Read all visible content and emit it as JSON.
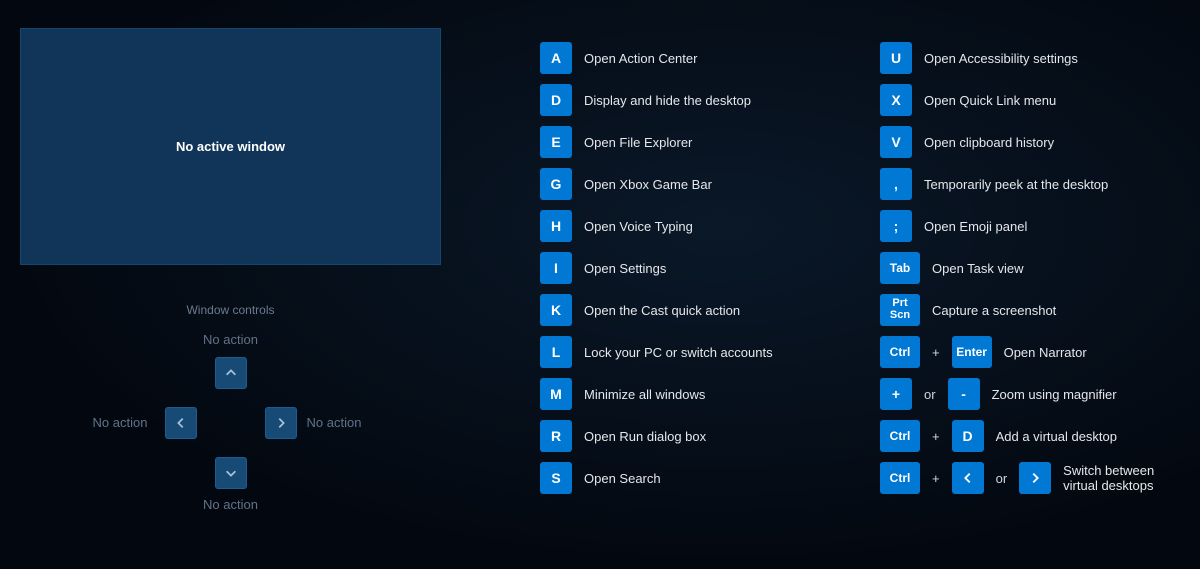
{
  "preview_text": "No active window",
  "window_controls_title": "Window controls",
  "dpad": {
    "up_label": "No action",
    "down_label": "No action",
    "left_label": "No action",
    "right_label": "No action"
  },
  "connectors": {
    "plus": "+",
    "or": "or"
  },
  "column1": [
    {
      "key": "A",
      "desc": "Open Action Center"
    },
    {
      "key": "D",
      "desc": "Display and hide the desktop"
    },
    {
      "key": "E",
      "desc": "Open File Explorer"
    },
    {
      "key": "G",
      "desc": "Open Xbox Game Bar"
    },
    {
      "key": "H",
      "desc": "Open Voice Typing"
    },
    {
      "key": "I",
      "desc": "Open Settings"
    },
    {
      "key": "K",
      "desc": "Open the Cast quick action"
    },
    {
      "key": "L",
      "desc": "Lock your PC or switch accounts"
    },
    {
      "key": "M",
      "desc": "Minimize all windows"
    },
    {
      "key": "R",
      "desc": "Open Run dialog box"
    },
    {
      "key": "S",
      "desc": "Open Search"
    }
  ],
  "column2_simple": [
    {
      "key": "U",
      "desc": "Open Accessibility settings"
    },
    {
      "key": "X",
      "desc": "Open Quick Link menu"
    },
    {
      "key": "V",
      "desc": "Open clipboard history"
    },
    {
      "key": ",",
      "desc": "Temporarily peek at the desktop"
    },
    {
      "key": ";",
      "desc": "Open Emoji panel"
    },
    {
      "key": "Tab",
      "desc": "Open Task view",
      "wide": true
    },
    {
      "key": "Prt\nScn",
      "desc": "Capture a screenshot",
      "tall": true
    }
  ],
  "combo_narrator": {
    "k1": "Ctrl",
    "k2": "Enter",
    "desc": "Open Narrator"
  },
  "combo_zoom": {
    "k1": "+",
    "k2": "-",
    "desc": "Zoom using magnifier"
  },
  "combo_add_desktop": {
    "k1": "Ctrl",
    "k2": "D",
    "desc": "Add a virtual desktop"
  },
  "combo_switch_desktops": {
    "k1": "Ctrl",
    "desc": "Switch between virtual desktops"
  }
}
